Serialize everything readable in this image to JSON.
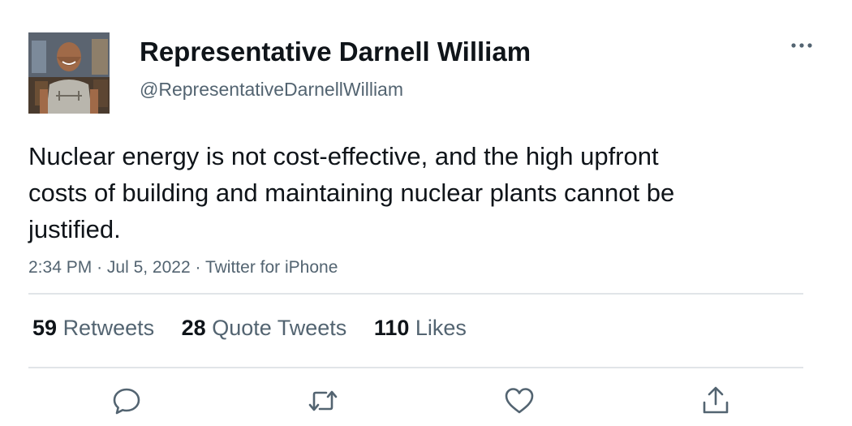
{
  "author": {
    "display_name": "Representative Darnell William",
    "handle": "@RepresentativeDarnellWilliam",
    "avatar": "profile-photo"
  },
  "tweet": {
    "text": "Nuclear energy is not cost-effective, and the high upfront costs of building and maintaining nuclear plants cannot be justified.",
    "time": "2:34 PM",
    "date": "Jul 5, 2022",
    "source": "Twitter for iPhone",
    "separator": "·"
  },
  "stats": {
    "retweets_count": "59",
    "retweets_label": "Retweets",
    "quotes_count": "28",
    "quotes_label": "Quote Tweets",
    "likes_count": "110",
    "likes_label": "Likes"
  },
  "icons": {
    "more": "more-dots-icon",
    "reply": "reply-icon",
    "retweet": "retweet-icon",
    "like": "like-icon",
    "share": "share-icon"
  },
  "colors": {
    "text_primary": "#0f1419",
    "text_secondary": "#536471",
    "divider": "#e1e5e8",
    "icon": "#536471"
  }
}
